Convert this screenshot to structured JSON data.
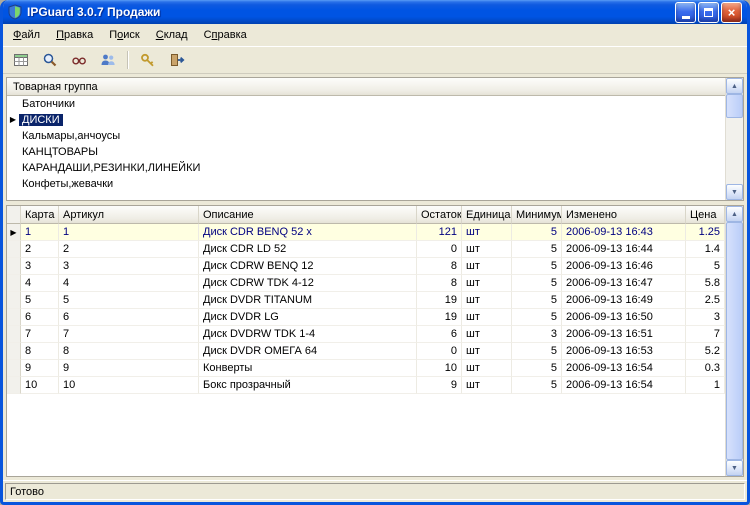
{
  "window": {
    "title": "IPGuard 3.0.7 Продажи",
    "status": "Готово"
  },
  "colors": {
    "titlebar": "#0054E3",
    "window_bg": "#ECE9D8",
    "group_selection_bg": "#0A246A",
    "group_selection_text": "#FFFFFF",
    "selected_row_bg": "#FFFFE1",
    "selected_row_text": "#000080"
  },
  "glyphs": {
    "row_marker": "▶",
    "scroll_up": "▲",
    "scroll_down": "▼",
    "close": "×"
  },
  "menu": {
    "items": [
      {
        "label": "Файл",
        "underline": 0
      },
      {
        "label": "Правка",
        "underline": 0
      },
      {
        "label": "Поиск",
        "underline": 1
      },
      {
        "label": "Склад",
        "underline": 0
      },
      {
        "label": "Справка",
        "underline": 1
      }
    ]
  },
  "toolbar": {
    "buttons": [
      {
        "icon": "table"
      },
      {
        "icon": "search"
      },
      {
        "icon": "eye"
      },
      {
        "icon": "users"
      },
      {
        "icon": "key"
      },
      {
        "icon": "exit"
      }
    ]
  },
  "groups": {
    "header": "Товарная группа",
    "selected_index": 1,
    "items": [
      "Батончики",
      "ДИСКИ",
      "Кальмары,анчоусы",
      "КАНЦТОВАРЫ",
      "КАРАНДАШИ,РЕЗИНКИ,ЛИНЕЙКИ",
      "Конфеты,жевачки"
    ]
  },
  "grid": {
    "columns": [
      "Карта",
      "Артикул",
      "Описание",
      "Остаток",
      "Единица",
      "Минимум",
      "Изменено",
      "Цена"
    ],
    "selected_index": 0,
    "rows": [
      {
        "karta": "1",
        "artikul": "1",
        "opisanie": "Диск CDR BENQ 52 x",
        "ostatok": "121",
        "edinitsa": "шт",
        "minimum": "5",
        "izmeneno": "2006-09-13 16:43",
        "tsena": "1.25"
      },
      {
        "karta": "2",
        "artikul": "2",
        "opisanie": "Диск CDR LD 52",
        "ostatok": "0",
        "edinitsa": "шт",
        "minimum": "5",
        "izmeneno": "2006-09-13 16:44",
        "tsena": "1.4"
      },
      {
        "karta": "3",
        "artikul": "3",
        "opisanie": "Диск CDRW BENQ 12",
        "ostatok": "8",
        "edinitsa": "шт",
        "minimum": "5",
        "izmeneno": "2006-09-13 16:46",
        "tsena": "5"
      },
      {
        "karta": "4",
        "artikul": "4",
        "opisanie": "Диск CDRW TDK 4-12",
        "ostatok": "8",
        "edinitsa": "шт",
        "minimum": "5",
        "izmeneno": "2006-09-13 16:47",
        "tsena": "5.8"
      },
      {
        "karta": "5",
        "artikul": "5",
        "opisanie": "Диск DVDR TITANUM",
        "ostatok": "19",
        "edinitsa": "шт",
        "minimum": "5",
        "izmeneno": "2006-09-13 16:49",
        "tsena": "2.5"
      },
      {
        "karta": "6",
        "artikul": "6",
        "opisanie": "Диск DVDR  LG",
        "ostatok": "19",
        "edinitsa": "шт",
        "minimum": "5",
        "izmeneno": "2006-09-13 16:50",
        "tsena": "3"
      },
      {
        "karta": "7",
        "artikul": "7",
        "opisanie": "Диск  DVDRW TDK 1-4",
        "ostatok": "6",
        "edinitsa": "шт",
        "minimum": "3",
        "izmeneno": "2006-09-13 16:51",
        "tsena": "7"
      },
      {
        "karta": "8",
        "artikul": "8",
        "opisanie": "Диск DVDR ОМЕГА 64",
        "ostatok": "0",
        "edinitsa": "шт",
        "minimum": "5",
        "izmeneno": "2006-09-13 16:53",
        "tsena": "5.2"
      },
      {
        "karta": "9",
        "artikul": "9",
        "opisanie": "Конверты",
        "ostatok": "10",
        "edinitsa": "шт",
        "minimum": "5",
        "izmeneno": "2006-09-13 16:54",
        "tsena": "0.3"
      },
      {
        "karta": "10",
        "artikul": "10",
        "opisanie": "Бокс прозрачный",
        "ostatok": "9",
        "edinitsa": "шт",
        "minimum": "5",
        "izmeneno": "2006-09-13 16:54",
        "tsena": "1"
      }
    ]
  }
}
